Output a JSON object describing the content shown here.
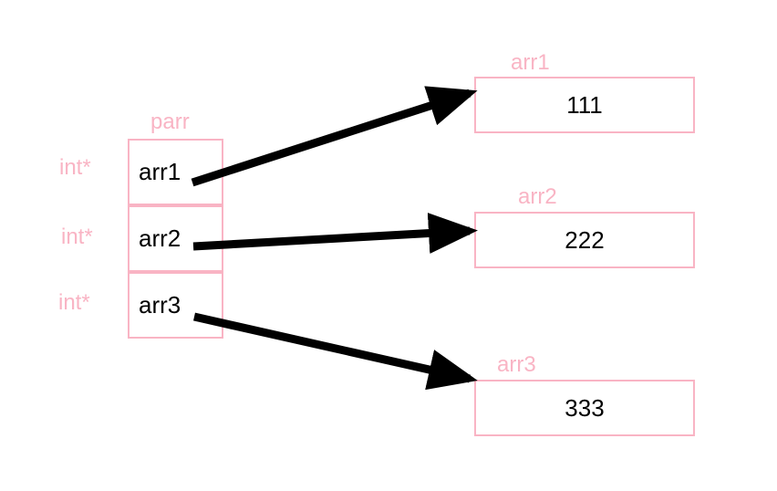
{
  "parr": {
    "label": "parr",
    "type_label": "int*",
    "cells": [
      {
        "name": "arr1"
      },
      {
        "name": "arr2"
      },
      {
        "name": "arr3"
      }
    ]
  },
  "targets": [
    {
      "label": "arr1",
      "value": "111"
    },
    {
      "label": "arr2",
      "value": "222"
    },
    {
      "label": "arr3",
      "value": "333"
    }
  ]
}
